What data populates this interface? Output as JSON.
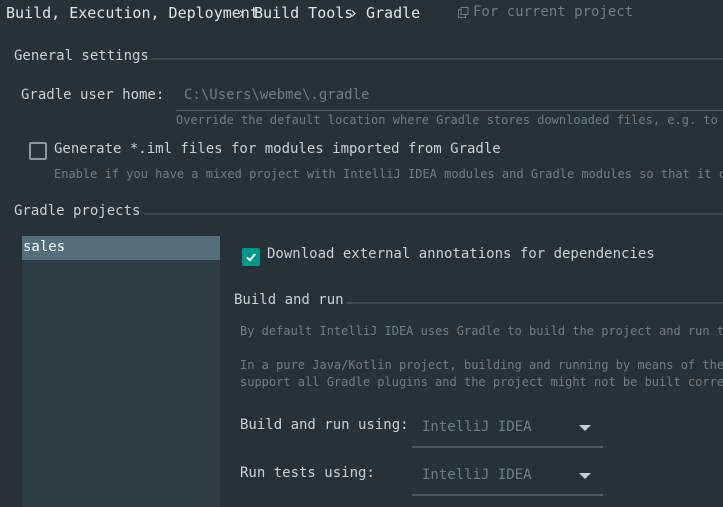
{
  "breadcrumb": {
    "items": [
      "Build, Execution, Deployment",
      "Build Tools",
      "Gradle"
    ],
    "separator": "›",
    "scope_label": "For current project"
  },
  "general": {
    "header": "General settings",
    "user_home_label": "Gradle user home:",
    "user_home_value": "C:\\Users\\webme\\.gradle",
    "user_home_hint": "Override the default location where Gradle stores downloaded files, e.g. to tu",
    "generate_iml_label": "Generate *.iml files for modules imported from Gradle",
    "generate_iml_checked": false,
    "generate_iml_hint": "Enable if you have a mixed project with IntelliJ IDEA modules and Gradle modules so that it coul"
  },
  "projects": {
    "header": "Gradle projects",
    "items": [
      "sales"
    ],
    "selected": "sales"
  },
  "project_settings": {
    "download_annotations_label": "Download external annotations for dependencies",
    "download_annotations_checked": true,
    "build_run_header": "Build and run",
    "desc_1": "By default IntelliJ IDEA uses Gradle to build the project and run the",
    "desc_2a": "In a pure Java/Kotlin project, building and running by means of the I",
    "desc_2b": "support all Gradle plugins and the project might not be built correct",
    "build_run_using_label": "Build and run using:",
    "build_run_using_value": "IntelliJ IDEA",
    "run_tests_using_label": "Run tests using:",
    "run_tests_using_value": "IntelliJ IDEA"
  },
  "colors": {
    "background": "#263238",
    "accent": "#009688",
    "selection": "#546e7a",
    "hint": "#6c7f88"
  }
}
